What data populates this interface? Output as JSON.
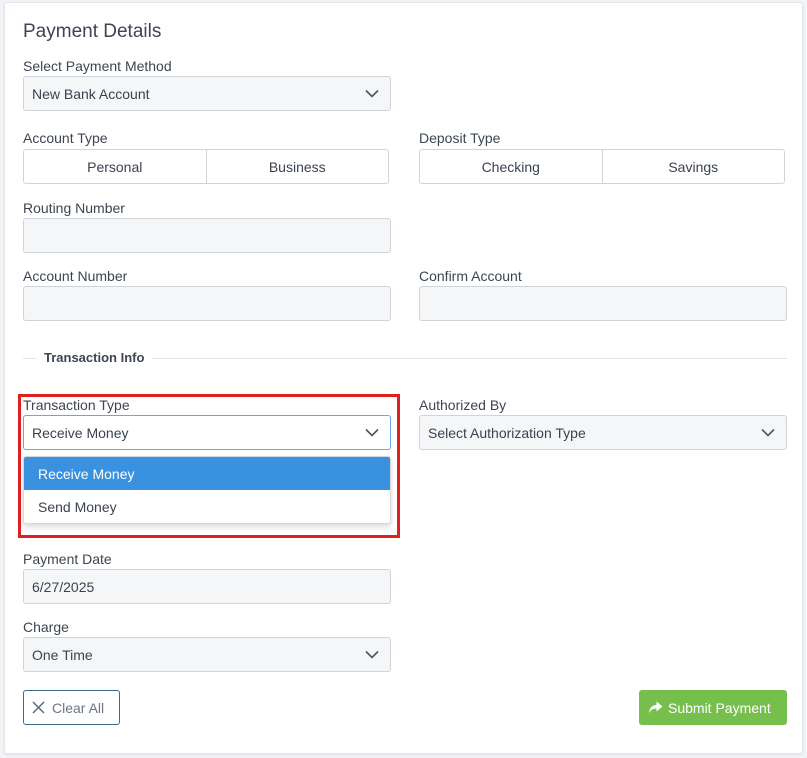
{
  "form": {
    "title": "Payment Details",
    "payment_method": {
      "label": "Select Payment Method",
      "value": "New Bank Account"
    },
    "account_type": {
      "label": "Account Type",
      "options": [
        "Personal",
        "Business"
      ]
    },
    "deposit_type": {
      "label": "Deposit Type",
      "options": [
        "Checking",
        "Savings"
      ]
    },
    "routing_number": {
      "label": "Routing Number",
      "value": ""
    },
    "account_number": {
      "label": "Account Number",
      "value": ""
    },
    "confirm_account": {
      "label": "Confirm Account",
      "value": ""
    }
  },
  "transaction": {
    "section_title": "Transaction Info",
    "type": {
      "label": "Transaction Type",
      "value": "Receive Money",
      "options": [
        "Receive Money",
        "Send Money"
      ],
      "selected_option": "Receive Money"
    },
    "authorized_by": {
      "label": "Authorized By",
      "value": "Select Authorization Type"
    },
    "payment_date": {
      "label": "Payment Date",
      "value": "6/27/2025"
    },
    "charge": {
      "label": "Charge",
      "value": "One Time"
    }
  },
  "actions": {
    "clear_label": "Clear All",
    "submit_label": "Submit Payment"
  },
  "colors": {
    "selected_option_bg": "#3a91e0",
    "submit_bg": "#76bf4d",
    "highlight_border": "#e0201f"
  },
  "icons": {
    "chevron": "chevron-down-icon",
    "clear": "close-icon",
    "submit": "share-arrow-icon"
  }
}
